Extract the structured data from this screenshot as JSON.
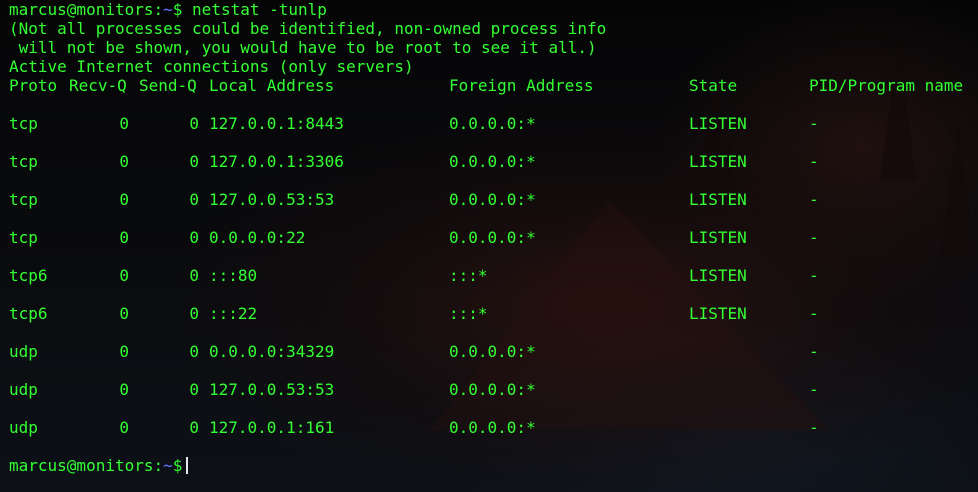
{
  "prompt": {
    "user_host": "marcus@monitors:",
    "path": "~",
    "symbol": "$"
  },
  "command": "netstat -tunlp",
  "notice_lines": [
    "(Not all processes could be identified, non-owned process info",
    " will not be shown, you would have to be root to see it all.)",
    "Active Internet connections (only servers)"
  ],
  "table": {
    "headers": {
      "proto": "Proto",
      "recv_q": "Recv-Q",
      "send_q": "Send-Q",
      "local": "Local Address",
      "foreign": "Foreign Address",
      "state": "State",
      "pid": "PID/Program name"
    },
    "rows": [
      {
        "proto": "tcp",
        "recv_q": "0",
        "send_q": "0",
        "local": "127.0.0.1:8443",
        "foreign": "0.0.0.0:*",
        "state": "LISTEN",
        "pid": "-"
      },
      {
        "proto": "tcp",
        "recv_q": "0",
        "send_q": "0",
        "local": "127.0.0.1:3306",
        "foreign": "0.0.0.0:*",
        "state": "LISTEN",
        "pid": "-"
      },
      {
        "proto": "tcp",
        "recv_q": "0",
        "send_q": "0",
        "local": "127.0.0.53:53",
        "foreign": "0.0.0.0:*",
        "state": "LISTEN",
        "pid": "-"
      },
      {
        "proto": "tcp",
        "recv_q": "0",
        "send_q": "0",
        "local": "0.0.0.0:22",
        "foreign": "0.0.0.0:*",
        "state": "LISTEN",
        "pid": "-"
      },
      {
        "proto": "tcp6",
        "recv_q": "0",
        "send_q": "0",
        "local": ":::80",
        "foreign": ":::*",
        "state": "LISTEN",
        "pid": "-"
      },
      {
        "proto": "tcp6",
        "recv_q": "0",
        "send_q": "0",
        "local": ":::22",
        "foreign": ":::*",
        "state": "LISTEN",
        "pid": "-"
      },
      {
        "proto": "udp",
        "recv_q": "0",
        "send_q": "0",
        "local": "0.0.0.0:34329",
        "foreign": "0.0.0.0:*",
        "state": "",
        "pid": "-"
      },
      {
        "proto": "udp",
        "recv_q": "0",
        "send_q": "0",
        "local": "127.0.0.53:53",
        "foreign": "0.0.0.0:*",
        "state": "",
        "pid": "-"
      },
      {
        "proto": "udp",
        "recv_q": "0",
        "send_q": "0",
        "local": "127.0.0.1:161",
        "foreign": "0.0.0.0:*",
        "state": "",
        "pid": "-"
      }
    ]
  },
  "colors": {
    "text": "#33ff33",
    "path": "#5b7cff",
    "cursor": "#e8e8e8"
  }
}
